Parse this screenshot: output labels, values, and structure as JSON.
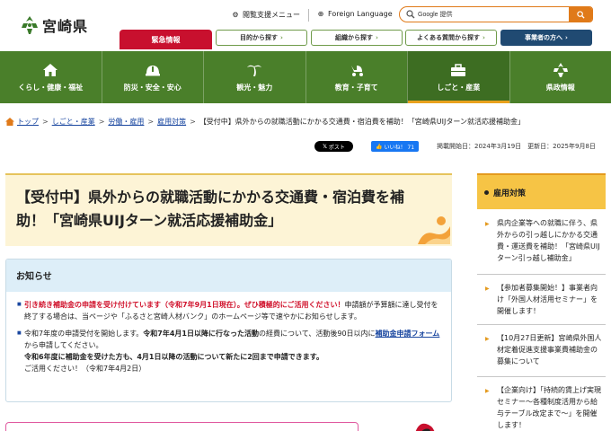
{
  "header": {
    "site_name": "宮崎県",
    "util_accessibility": "閲覧支援メニュー",
    "util_language": "Foreign Language",
    "search_placeholder": "Google 提供",
    "emergency": "緊急情報",
    "quick_links": [
      "目的から探す",
      "組織から探す",
      "よくある質問から探す"
    ],
    "business_link": "事業者の方へ"
  },
  "nav": {
    "items": [
      {
        "label": "くらし・健康・福祉",
        "icon": "house-icon"
      },
      {
        "label": "防災・安全・安心",
        "icon": "helmet-icon"
      },
      {
        "label": "観光・魅力",
        "icon": "palm-tree-icon"
      },
      {
        "label": "教育・子育て",
        "icon": "stroller-icon"
      },
      {
        "label": "しごと・産業",
        "icon": "briefcase-icon"
      },
      {
        "label": "県政情報",
        "icon": "prefecture-emblem-icon"
      }
    ],
    "active_index": 4
  },
  "breadcrumb": {
    "links": [
      "トップ",
      "しごと・産業",
      "労働・雇用",
      "雇用対策"
    ],
    "current": "【受付中】県外からの就職活動にかかる交通費・宿泊費を補助！「宮崎県UIJターン就活応援補助金」"
  },
  "share": {
    "x_label": "ポスト",
    "fb_label": "いいね！ 71"
  },
  "dates": "掲載開始日：2024年3月19日　更新日：2025年9月8日",
  "title": "【受付中】県外からの就職活動にかかる交通費・宿泊費を補助！「宮崎県UIJターン就活応援補助金」",
  "notice": {
    "heading": "お知らせ",
    "item1_red": "引き続き補助金の申請を受け付けています（令和7年9月1日現在）。ぜひ積極的にご活用ください！",
    "item1_rest": "申請額が予算額に達し受付を終了する場合は、当ページや「ふるさと宮崎人材バンク」のホームページ等で速やかにお知らせします。",
    "item2_a": "令和7年度の申請受付を開始します。",
    "item2_b": "令和7年4月1日以降に行なった活動",
    "item2_c": "の経費について、活動後90日以内に",
    "item2_link": "補助金申請フォーム",
    "item2_d": "から申請してください。",
    "item2_e": "令和6年度に補助金を受けた方も、4月1日以降の活動について新たに2回まで申請できます。",
    "item2_f": "ご活用ください！（令和7年4月2日）"
  },
  "sidebar": {
    "heading": "雇用対策",
    "items": [
      "県内企業等への就職に伴う、県外からの引っ越しにかかる交通費・運送費を補助！「宮崎県UIJターン引っ越し補助金」",
      "【参加者募集開始！】事業者向け「外国人材活用セミナー」を開催します！",
      "【10月27日更新】宮崎県外国人材定着促進支援事業費補助金の募集について",
      "【企業向け】「持続的賃上げ実現セミナー～各種制度活用から給与テーブル改定まで～」を開催します！"
    ]
  },
  "colors": {
    "nav_green": "#4a7f2a",
    "emergency_red": "#c8102e",
    "business_navy": "#204a72",
    "accent_orange": "#e07a19",
    "link_blue": "#1a47a0"
  }
}
